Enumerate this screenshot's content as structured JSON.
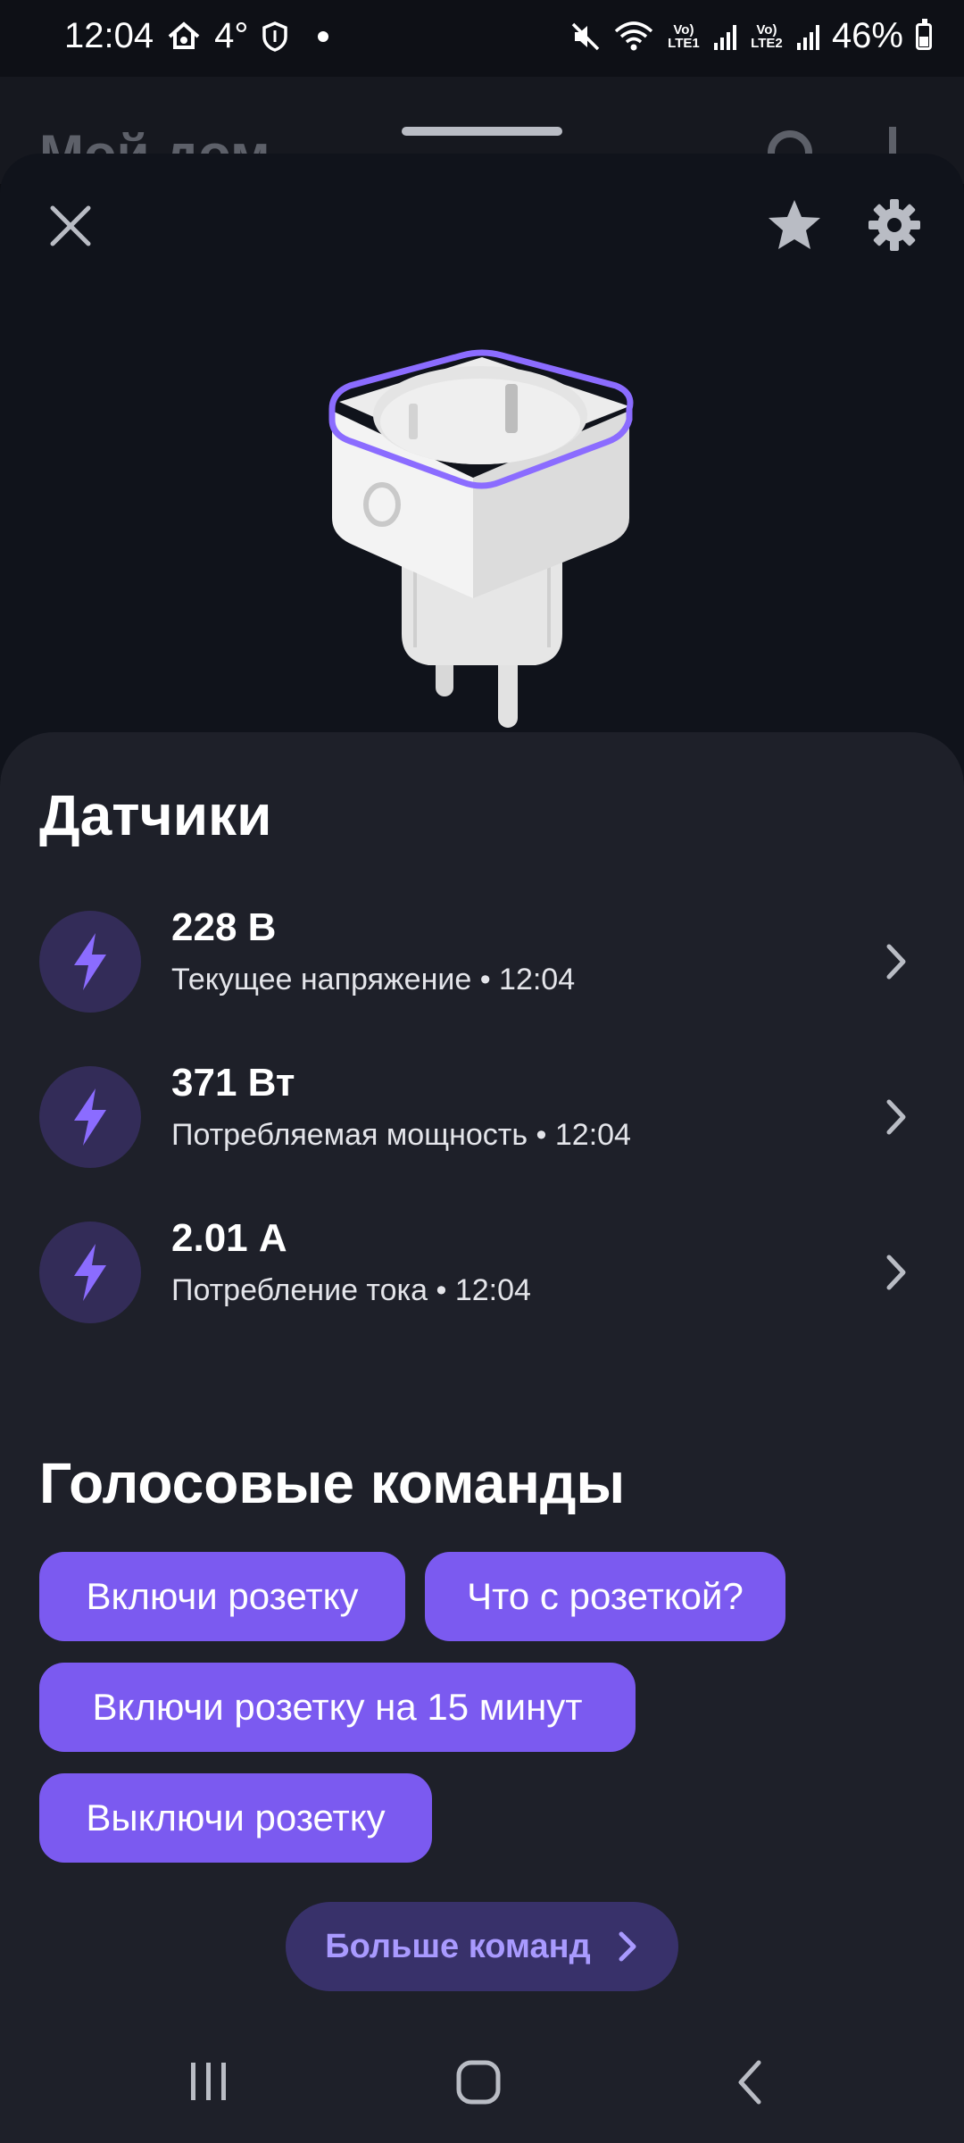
{
  "status_bar": {
    "time": "12:04",
    "temperature": "4°",
    "battery": "46%",
    "sim1": "Vo) LTE1",
    "sim2": "Vo) LTE2",
    "icons": [
      "home-alert-icon",
      "shield-icon",
      "mute-icon",
      "wifi-icon",
      "signal-icon",
      "battery-icon"
    ]
  },
  "background_page": {
    "title": "Мой дом"
  },
  "header": {
    "close_icon": "close-icon",
    "favorite_icon": "star-icon",
    "settings_icon": "gear-icon"
  },
  "device": {
    "image": "smart-plug-image",
    "accent_color": "#8b6cff"
  },
  "sensors": {
    "title": "Датчики",
    "items": [
      {
        "value": "228 В",
        "label": "Текущее напряжение • 12:04",
        "icon": "lightning-icon"
      },
      {
        "value": "371 Вт",
        "label": "Потребляемая мощность • 12:04",
        "icon": "lightning-icon"
      },
      {
        "value": "2.01 А",
        "label": "Потребление тока • 12:04",
        "icon": "lightning-icon"
      }
    ]
  },
  "voice_commands": {
    "title": "Голосовые команды",
    "chips": [
      "Включи розетку",
      "Что с розеткой?",
      "Включи розетку на 15 минут",
      "Выключи розетку"
    ],
    "more_label": "Больше команд"
  },
  "colors": {
    "accent": "#7b5af0",
    "panel_bg": "#1e2029",
    "sheet_bg": "#10131b",
    "icon_circle": "#332c58"
  },
  "nav": {
    "icons": [
      "recents-icon",
      "home-icon",
      "back-icon"
    ]
  }
}
